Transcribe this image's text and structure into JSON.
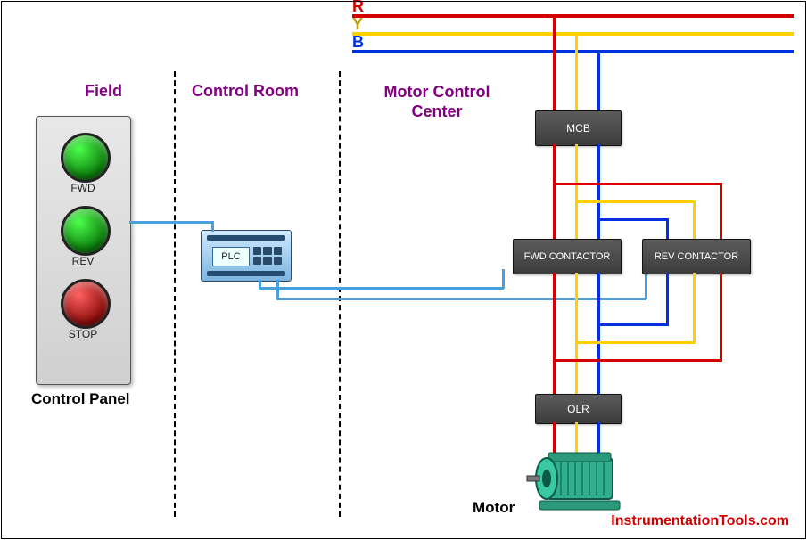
{
  "sections": {
    "field": "Field",
    "control_room": "Control Room",
    "mcc": "Motor Control Center"
  },
  "panel": {
    "caption": "Control Panel",
    "fwd": "FWD",
    "rev": "REV",
    "stop": "STOP"
  },
  "plc": {
    "label": "PLC"
  },
  "phases": {
    "r": "R",
    "y": "Y",
    "b": "B"
  },
  "blocks": {
    "mcb": "MCB",
    "fwd_contactor": "FWD CONTACTOR",
    "rev_contactor": "REV CONTACTOR",
    "olr": "OLR"
  },
  "motor": {
    "caption": "Motor"
  },
  "watermark": "InstrumentationTools.com",
  "colors": {
    "r": "#d40000",
    "y": "#ffd000",
    "b": "#0030e0",
    "plc_wire": "#4aa0dc",
    "purple": "#800080"
  },
  "chart_data": {
    "type": "diagram",
    "nodes": [
      {
        "id": "control_panel",
        "section": "Field",
        "label": "Control Panel",
        "buttons": [
          "FWD",
          "REV",
          "STOP"
        ]
      },
      {
        "id": "plc",
        "section": "Control Room",
        "label": "PLC"
      },
      {
        "id": "mcb",
        "section": "Motor Control Center",
        "label": "MCB"
      },
      {
        "id": "fwd_contactor",
        "section": "Motor Control Center",
        "label": "FWD CONTACTOR"
      },
      {
        "id": "rev_contactor",
        "section": "Motor Control Center",
        "label": "REV CONTACTOR"
      },
      {
        "id": "olr",
        "section": "Motor Control Center",
        "label": "OLR"
      },
      {
        "id": "motor",
        "section": "Motor Control Center",
        "label": "Motor"
      }
    ],
    "buses": [
      {
        "id": "R",
        "color": "#d40000"
      },
      {
        "id": "Y",
        "color": "#ffd000"
      },
      {
        "id": "B",
        "color": "#0030e0"
      }
    ],
    "edges": [
      {
        "from": "control_panel",
        "to": "plc",
        "kind": "signal"
      },
      {
        "from": "plc",
        "to": "fwd_contactor",
        "kind": "signal"
      },
      {
        "from": "plc",
        "to": "rev_contactor",
        "kind": "signal"
      },
      {
        "from": "R",
        "to": "mcb",
        "kind": "power"
      },
      {
        "from": "Y",
        "to": "mcb",
        "kind": "power"
      },
      {
        "from": "B",
        "to": "mcb",
        "kind": "power"
      },
      {
        "from": "mcb",
        "to": "fwd_contactor",
        "kind": "power_RYB"
      },
      {
        "from": "mcb",
        "to": "rev_contactor",
        "kind": "power_RYB_swapped"
      },
      {
        "from": "fwd_contactor",
        "to": "olr",
        "kind": "power_RYB"
      },
      {
        "from": "rev_contactor",
        "to": "olr",
        "kind": "power_RYB"
      },
      {
        "from": "olr",
        "to": "motor",
        "kind": "power_RYB"
      }
    ],
    "sections": [
      "Field",
      "Control Room",
      "Motor Control Center"
    ]
  }
}
